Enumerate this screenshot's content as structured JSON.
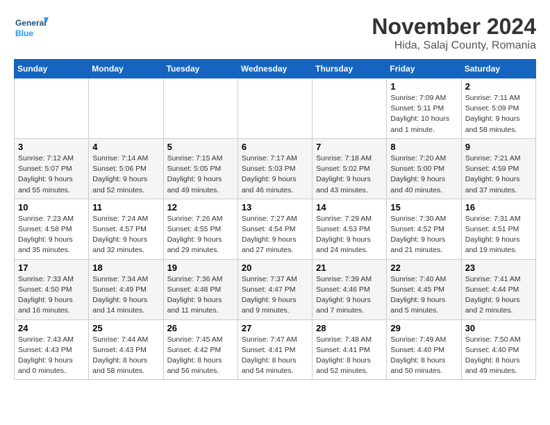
{
  "header": {
    "logo_line1": "General",
    "logo_line2": "Blue",
    "title": "November 2024",
    "subtitle": "Hida, Salaj County, Romania"
  },
  "weekdays": [
    "Sunday",
    "Monday",
    "Tuesday",
    "Wednesday",
    "Thursday",
    "Friday",
    "Saturday"
  ],
  "weeks": [
    [
      {
        "day": "",
        "info": ""
      },
      {
        "day": "",
        "info": ""
      },
      {
        "day": "",
        "info": ""
      },
      {
        "day": "",
        "info": ""
      },
      {
        "day": "",
        "info": ""
      },
      {
        "day": "1",
        "info": "Sunrise: 7:09 AM\nSunset: 5:11 PM\nDaylight: 10 hours and 1 minute."
      },
      {
        "day": "2",
        "info": "Sunrise: 7:11 AM\nSunset: 5:09 PM\nDaylight: 9 hours and 58 minutes."
      }
    ],
    [
      {
        "day": "3",
        "info": "Sunrise: 7:12 AM\nSunset: 5:07 PM\nDaylight: 9 hours and 55 minutes."
      },
      {
        "day": "4",
        "info": "Sunrise: 7:14 AM\nSunset: 5:06 PM\nDaylight: 9 hours and 52 minutes."
      },
      {
        "day": "5",
        "info": "Sunrise: 7:15 AM\nSunset: 5:05 PM\nDaylight: 9 hours and 49 minutes."
      },
      {
        "day": "6",
        "info": "Sunrise: 7:17 AM\nSunset: 5:03 PM\nDaylight: 9 hours and 46 minutes."
      },
      {
        "day": "7",
        "info": "Sunrise: 7:18 AM\nSunset: 5:02 PM\nDaylight: 9 hours and 43 minutes."
      },
      {
        "day": "8",
        "info": "Sunrise: 7:20 AM\nSunset: 5:00 PM\nDaylight: 9 hours and 40 minutes."
      },
      {
        "day": "9",
        "info": "Sunrise: 7:21 AM\nSunset: 4:59 PM\nDaylight: 9 hours and 37 minutes."
      }
    ],
    [
      {
        "day": "10",
        "info": "Sunrise: 7:23 AM\nSunset: 4:58 PM\nDaylight: 9 hours and 35 minutes."
      },
      {
        "day": "11",
        "info": "Sunrise: 7:24 AM\nSunset: 4:57 PM\nDaylight: 9 hours and 32 minutes."
      },
      {
        "day": "12",
        "info": "Sunrise: 7:26 AM\nSunset: 4:55 PM\nDaylight: 9 hours and 29 minutes."
      },
      {
        "day": "13",
        "info": "Sunrise: 7:27 AM\nSunset: 4:54 PM\nDaylight: 9 hours and 27 minutes."
      },
      {
        "day": "14",
        "info": "Sunrise: 7:29 AM\nSunset: 4:53 PM\nDaylight: 9 hours and 24 minutes."
      },
      {
        "day": "15",
        "info": "Sunrise: 7:30 AM\nSunset: 4:52 PM\nDaylight: 9 hours and 21 minutes."
      },
      {
        "day": "16",
        "info": "Sunrise: 7:31 AM\nSunset: 4:51 PM\nDaylight: 9 hours and 19 minutes."
      }
    ],
    [
      {
        "day": "17",
        "info": "Sunrise: 7:33 AM\nSunset: 4:50 PM\nDaylight: 9 hours and 16 minutes."
      },
      {
        "day": "18",
        "info": "Sunrise: 7:34 AM\nSunset: 4:49 PM\nDaylight: 9 hours and 14 minutes."
      },
      {
        "day": "19",
        "info": "Sunrise: 7:36 AM\nSunset: 4:48 PM\nDaylight: 9 hours and 11 minutes."
      },
      {
        "day": "20",
        "info": "Sunrise: 7:37 AM\nSunset: 4:47 PM\nDaylight: 9 hours and 9 minutes."
      },
      {
        "day": "21",
        "info": "Sunrise: 7:39 AM\nSunset: 4:46 PM\nDaylight: 9 hours and 7 minutes."
      },
      {
        "day": "22",
        "info": "Sunrise: 7:40 AM\nSunset: 4:45 PM\nDaylight: 9 hours and 5 minutes."
      },
      {
        "day": "23",
        "info": "Sunrise: 7:41 AM\nSunset: 4:44 PM\nDaylight: 9 hours and 2 minutes."
      }
    ],
    [
      {
        "day": "24",
        "info": "Sunrise: 7:43 AM\nSunset: 4:43 PM\nDaylight: 9 hours and 0 minutes."
      },
      {
        "day": "25",
        "info": "Sunrise: 7:44 AM\nSunset: 4:43 PM\nDaylight: 8 hours and 58 minutes."
      },
      {
        "day": "26",
        "info": "Sunrise: 7:45 AM\nSunset: 4:42 PM\nDaylight: 8 hours and 56 minutes."
      },
      {
        "day": "27",
        "info": "Sunrise: 7:47 AM\nSunset: 4:41 PM\nDaylight: 8 hours and 54 minutes."
      },
      {
        "day": "28",
        "info": "Sunrise: 7:48 AM\nSunset: 4:41 PM\nDaylight: 8 hours and 52 minutes."
      },
      {
        "day": "29",
        "info": "Sunrise: 7:49 AM\nSunset: 4:40 PM\nDaylight: 8 hours and 50 minutes."
      },
      {
        "day": "30",
        "info": "Sunrise: 7:50 AM\nSunset: 4:40 PM\nDaylight: 8 hours and 49 minutes."
      }
    ]
  ]
}
